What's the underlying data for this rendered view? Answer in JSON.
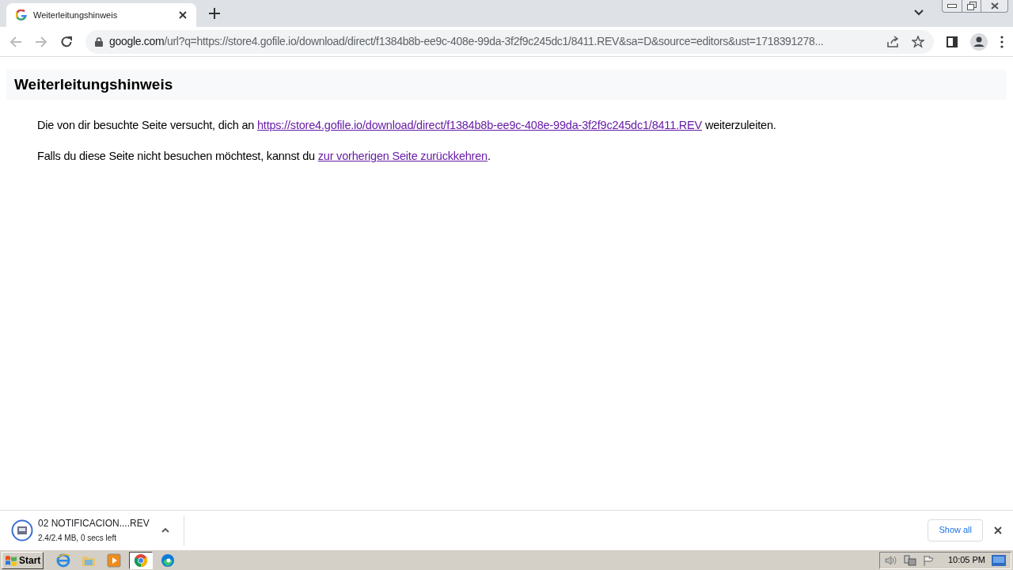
{
  "tab": {
    "title": "Weiterleitungshinweis",
    "selected": true
  },
  "address_bar": {
    "domain": "google.com",
    "path": "/url?q=https://store4.gofile.io/download/direct/f1384b8b-ee9c-408e-99da-3f2f9c245dc1/8411.REV&sa=D&source=editors&ust=1718391278..."
  },
  "page": {
    "heading": "Weiterleitungshinweis",
    "paragraphs": [
      {
        "before": "Die von dir besuchte Seite versucht, dich an ",
        "link": "https://store4.gofile.io/download/direct/f1384b8b-ee9c-408e-99da-3f2f9c245dc1/8411.REV",
        "after": " weiterzuleiten."
      },
      {
        "before": "Falls du diese Seite nicht besuchen möchtest, kannst du ",
        "link": "zur vorherigen Seite zurückkehren",
        "after": "."
      }
    ]
  },
  "download_bar": {
    "filename": "02 NOTIFICACION....REV",
    "status": "2.4/2.4 MB, 0 secs left",
    "show_all": "Show all"
  },
  "taskbar": {
    "start": "Start",
    "apps": [
      {
        "kind": "ie",
        "selected": false
      },
      {
        "kind": "folder",
        "selected": false
      },
      {
        "kind": "media",
        "selected": false
      },
      {
        "kind": "chrome",
        "selected": true
      },
      {
        "kind": "edge",
        "selected": false
      }
    ],
    "clock": "10:05 PM"
  }
}
